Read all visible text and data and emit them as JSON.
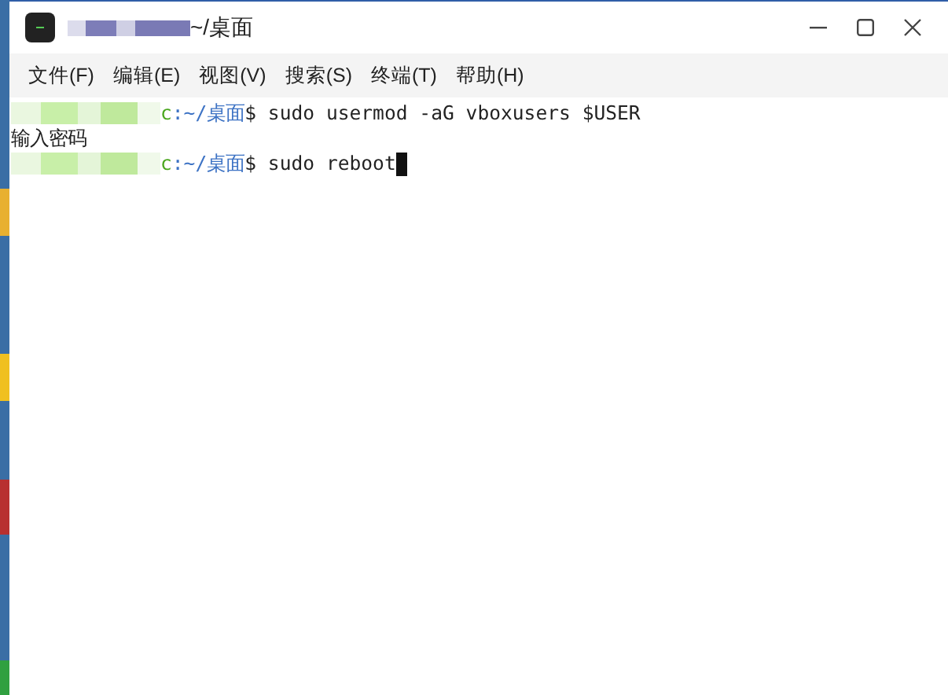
{
  "window": {
    "title": "~/桌面",
    "title_redacted": true
  },
  "menu": [
    {
      "label": "文件(F)"
    },
    {
      "label": "编辑(E)"
    },
    {
      "label": "视图(V)"
    },
    {
      "label": "搜索(S)"
    },
    {
      "label": "终端(T)"
    },
    {
      "label": "帮助(H)"
    }
  ],
  "terminal": {
    "lines": [
      {
        "kind": "prompt",
        "user_redacted": true,
        "host": "c",
        "path": ":~/桌面",
        "command": "$ sudo usermod -aG vboxusers $USER",
        "cursor": false
      },
      {
        "kind": "output",
        "text": "输入密码"
      },
      {
        "kind": "prompt",
        "user_redacted": true,
        "host": "c",
        "path": ":~/桌面",
        "command": "$ sudo reboot",
        "cursor": true
      }
    ]
  }
}
